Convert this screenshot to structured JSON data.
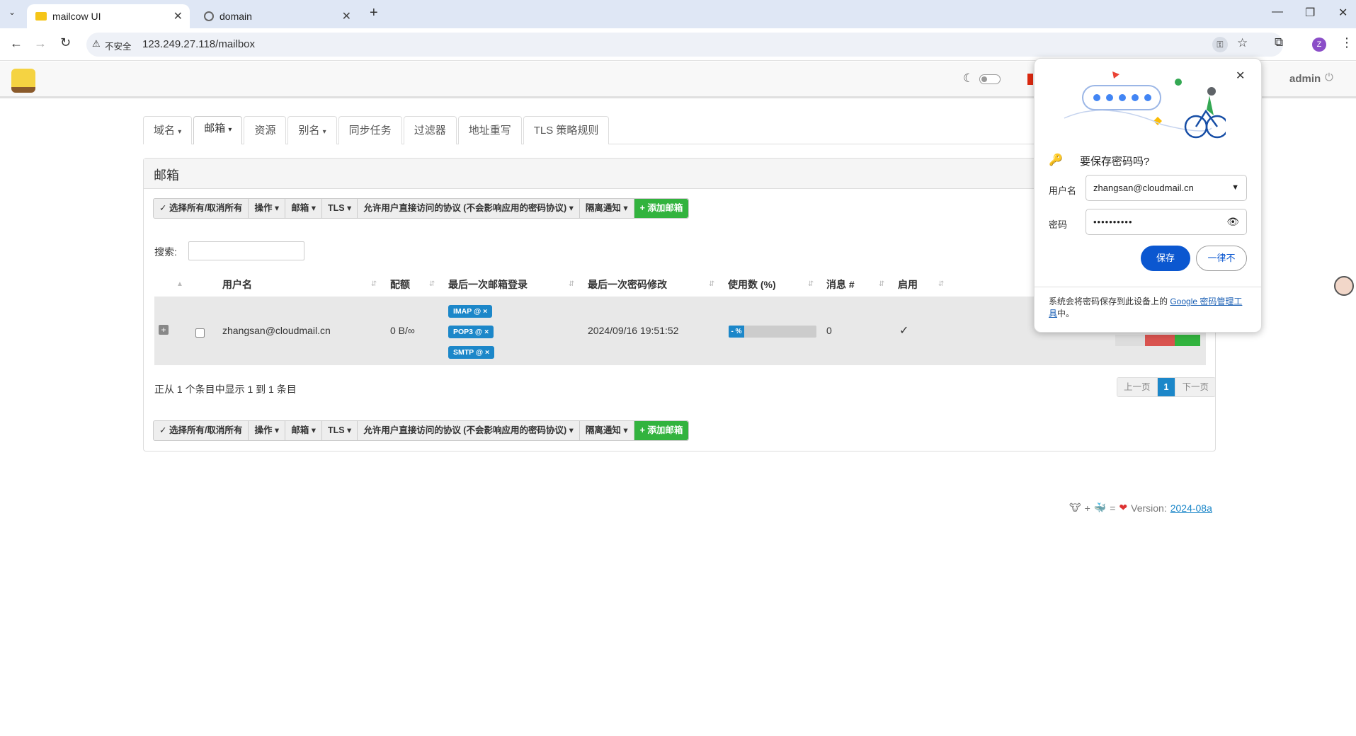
{
  "browser": {
    "tabs": [
      {
        "title": "mailcow UI",
        "active": true
      },
      {
        "title": "domain",
        "active": false
      }
    ],
    "security_label": "不安全",
    "url": "123.249.27.118/mailbox",
    "profile_initial": "Z"
  },
  "topnav": {
    "user": "admin"
  },
  "nav_tabs": [
    "域名",
    "邮箱",
    "资源",
    "别名",
    "同步任务",
    "过滤器",
    "地址重写",
    "TLS 策略规则"
  ],
  "panel": {
    "title": "邮箱",
    "search_label": "搜索:",
    "search_value": "",
    "actions": {
      "select_all": "选择所有/取消所有",
      "operation": "操作",
      "mailbox": "邮箱",
      "tls": "TLS",
      "protocols": "允许用户直接访问的协议 (不会影响应用的密码协议)",
      "quarantine": "隔离通知",
      "add": "+ 添加邮箱"
    },
    "table": {
      "headers": [
        "用户名",
        "配额",
        "最后一次邮箱登录",
        "最后一次密码修改",
        "使用数 (%)",
        "消息 #",
        "启用"
      ],
      "rows": [
        {
          "username": "zhangsan@cloudmail.cn",
          "quota": "0 B/∞",
          "badges": [
            "IMAP @ ×",
            "POP3 @ ×",
            "SMTP @ ×"
          ],
          "pw_changed": "2024/09/16 19:51:52",
          "usage": "- %",
          "messages": "0",
          "enabled": "✓"
        }
      ]
    },
    "info": "正从 1 个条目中显示 1 到 1 条目",
    "pager": {
      "prev": "上一页",
      "current": "1",
      "next": "下一页"
    }
  },
  "footer": {
    "version_label": "Version:",
    "version": "2024-08a"
  },
  "password_popup": {
    "title": "要保存密码吗?",
    "username_label": "用户名",
    "username": "zhangsan@cloudmail.cn",
    "password_label": "密码",
    "password_mask": "••••••••••",
    "save": "保存",
    "never": "一律不",
    "note_prefix": "系统会将密码保存到此设备上的 ",
    "note_link": "Google 密码管理工具",
    "note_suffix": "中。"
  },
  "colors": {
    "accent_blue": "#1c87c9",
    "green": "#32b33e",
    "chrome_blue": "#0b57d0"
  }
}
